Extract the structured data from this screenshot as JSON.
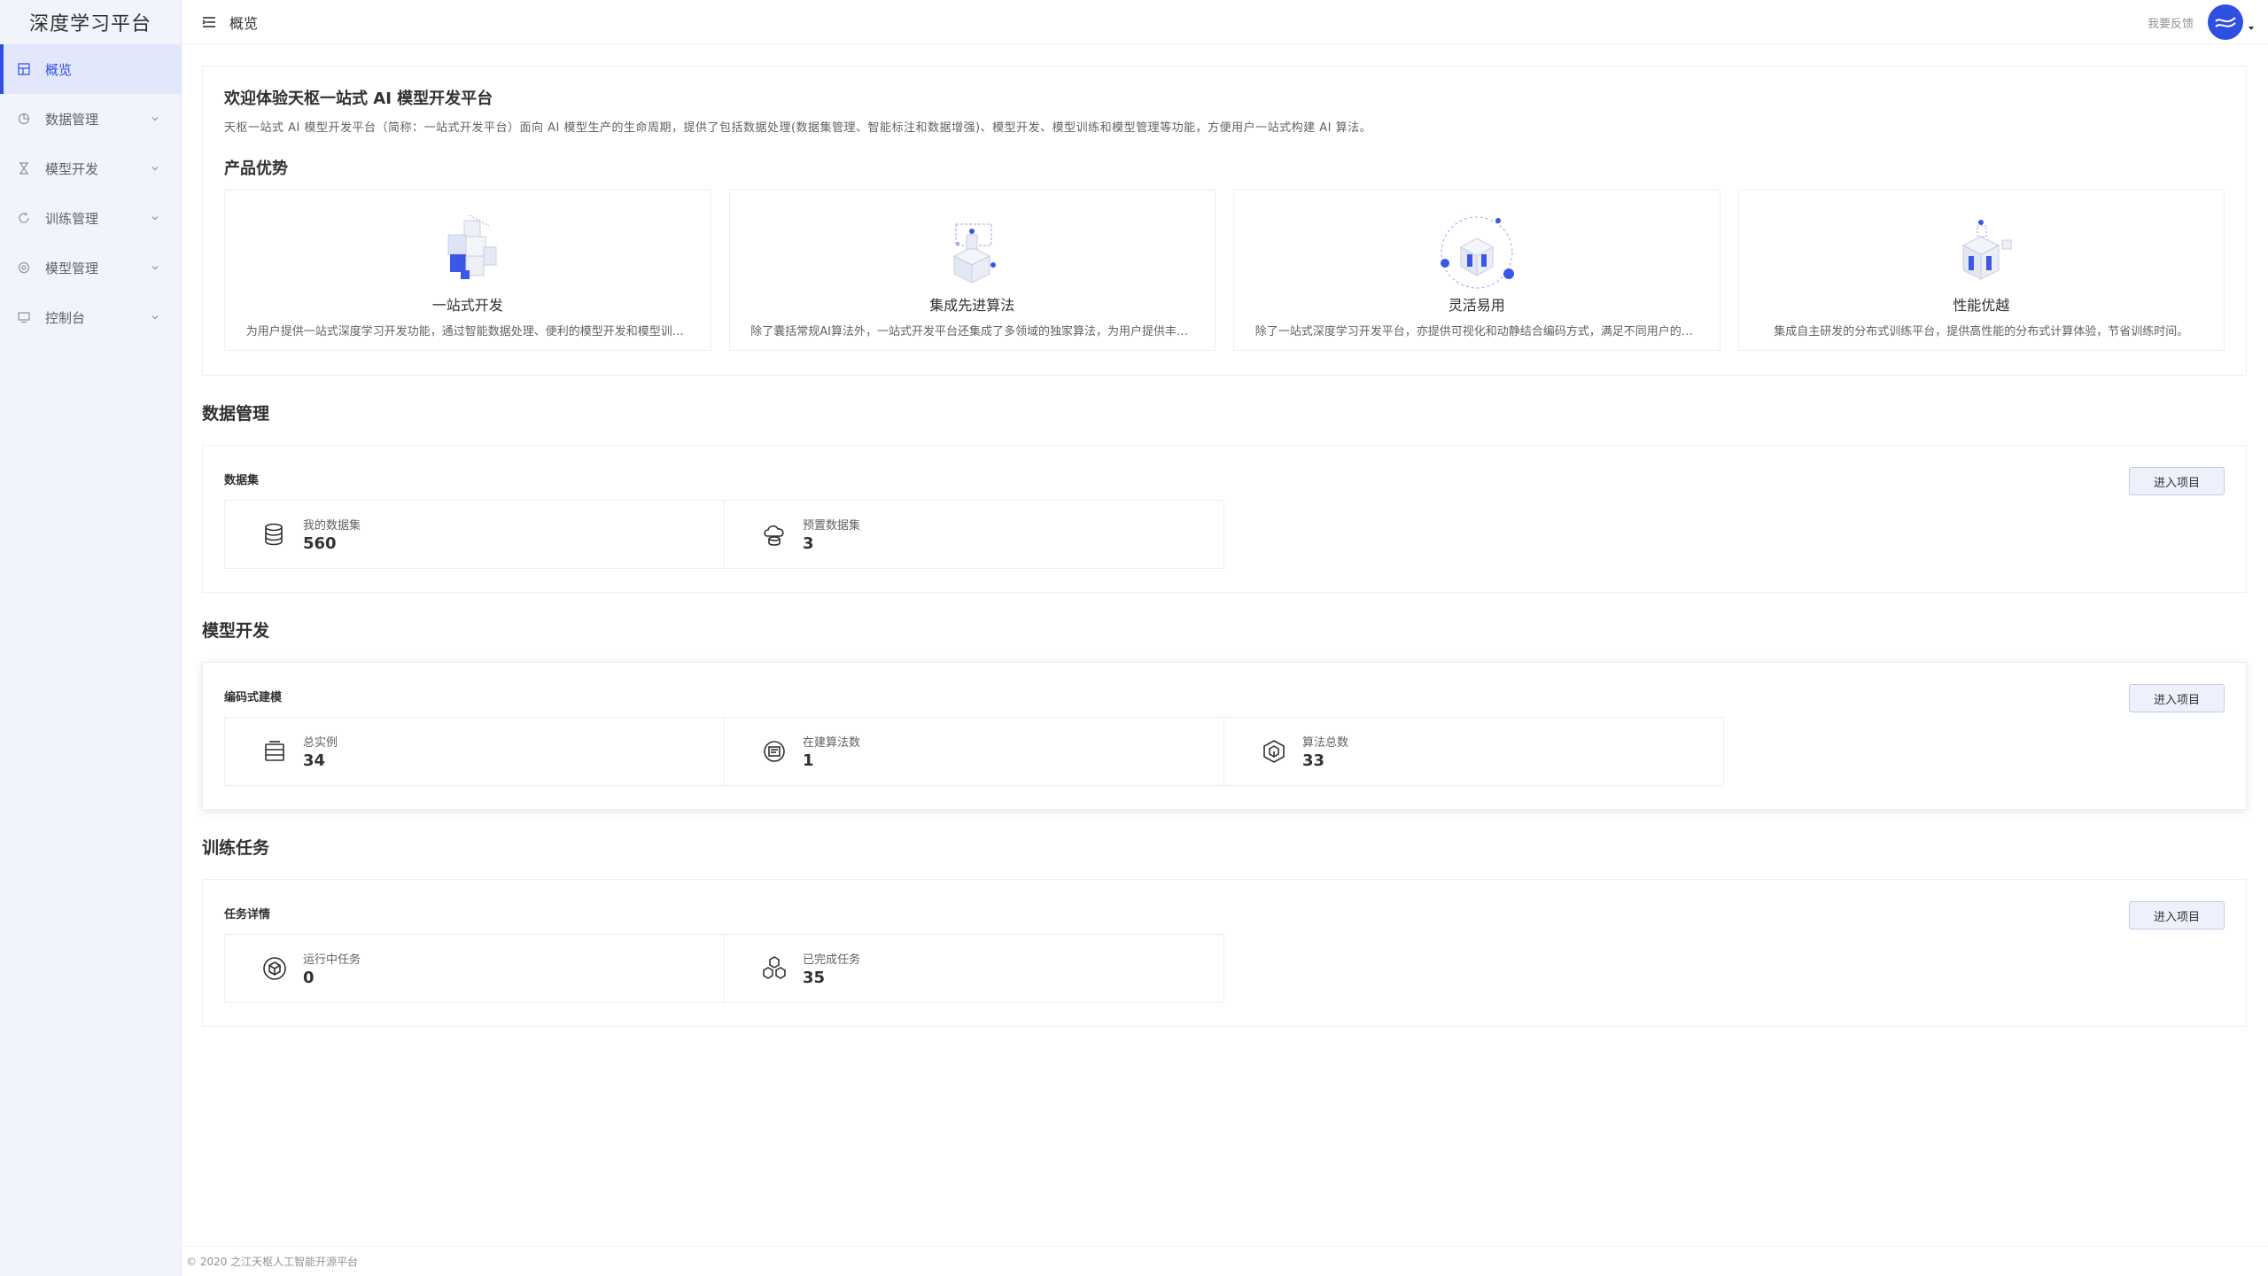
{
  "app": {
    "logo": "深度学习平台"
  },
  "sidebar": {
    "items": [
      {
        "label": "概览",
        "icon": "dashboard-icon",
        "active": true
      },
      {
        "label": "数据管理",
        "icon": "pie-chart-icon"
      },
      {
        "label": "模型开发",
        "icon": "hourglass-icon"
      },
      {
        "label": "训练管理",
        "icon": "cycle-icon"
      },
      {
        "label": "模型管理",
        "icon": "model-icon"
      },
      {
        "label": "控制台",
        "icon": "console-icon"
      }
    ]
  },
  "header": {
    "breadcrumb": "概览",
    "feedback": "我要反馈"
  },
  "intro": {
    "title": "欢迎体验天枢一站式 AI 模型开发平台",
    "description": "天枢一站式 AI 模型开发平台（简称：一站式开发平台）面向 AI 模型生产的生命周期，提供了包括数据处理(数据集管理、智能标注和数据增强)、模型开发、模型训练和模型管理等功能，方便用户一站式构建 AI 算法。",
    "advantages_title": "产品优势",
    "advantages": [
      {
        "name": "一站式开发",
        "desc": "为用户提供一站式深度学习开发功能，通过智能数据处理、便利的模型开发和模型训练等功能，实现一站式构建 AI 算法。"
      },
      {
        "name": "集成先进算法",
        "desc": "除了囊括常规AI算法外，一站式开发平台还集成了多领域的独家算法，为用户提供丰富的算法选择。"
      },
      {
        "name": "灵活易用",
        "desc": "除了一站式深度学习开发平台，亦提供可视化和动静结合编码方式，满足不同用户的使用需求。"
      },
      {
        "name": "性能优越",
        "desc": "集成自主研发的分布式训练平台，提供高性能的分布式计算体验，节省训练时间。"
      }
    ]
  },
  "data_section": {
    "title": "数据管理",
    "subtitle": "数据集",
    "button": "进入项目",
    "stats": [
      {
        "label": "我的数据集",
        "value": "560",
        "icon": "database-icon"
      },
      {
        "label": "预置数据集",
        "value": "3",
        "icon": "cloud-dataset-icon"
      }
    ]
  },
  "model_section": {
    "title": "模型开发",
    "subtitle": "编码式建模",
    "button": "进入项目",
    "stats": [
      {
        "label": "总实例",
        "value": "34",
        "icon": "instance-icon"
      },
      {
        "label": "在建算法数",
        "value": "1",
        "icon": "algorithm-building-icon"
      },
      {
        "label": "算法总数",
        "value": "33",
        "icon": "algorithm-cube-icon"
      }
    ]
  },
  "train_section": {
    "title": "训练任务",
    "subtitle": "任务详情",
    "button": "进入项目",
    "stats": [
      {
        "label": "运行中任务",
        "value": "0",
        "icon": "running-task-icon"
      },
      {
        "label": "已完成任务",
        "value": "35",
        "icon": "completed-task-icon"
      }
    ]
  },
  "footer": {
    "text": "© 2020 之江天枢人工智能开源平台"
  },
  "colors": {
    "accent": "#2e4fe0",
    "sidebar_bg": "#f2f4fc",
    "border": "#ebeef5"
  }
}
